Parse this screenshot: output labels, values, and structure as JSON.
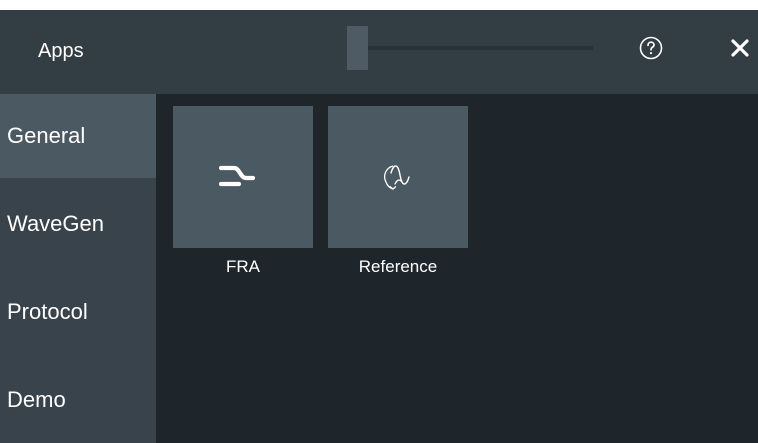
{
  "header": {
    "title": "Apps",
    "help_icon": "question-circle-icon",
    "close_icon": "close-x-icon"
  },
  "sidebar": {
    "items": [
      {
        "label": "General",
        "active": true
      },
      {
        "label": "WaveGen",
        "active": false
      },
      {
        "label": "Protocol",
        "active": false
      },
      {
        "label": "Demo",
        "active": false
      }
    ]
  },
  "apps": [
    {
      "label": "FRA",
      "icon": "fra-step-response-icon"
    },
    {
      "label": "Reference",
      "icon": "reference-waveform-icon"
    }
  ],
  "colors": {
    "background": "#1f262b",
    "titlebar": "#333d44",
    "sidebar": "#38434b",
    "sidebar_active": "#4b5962",
    "tile": "#4a5962",
    "text": "#ffffff"
  }
}
